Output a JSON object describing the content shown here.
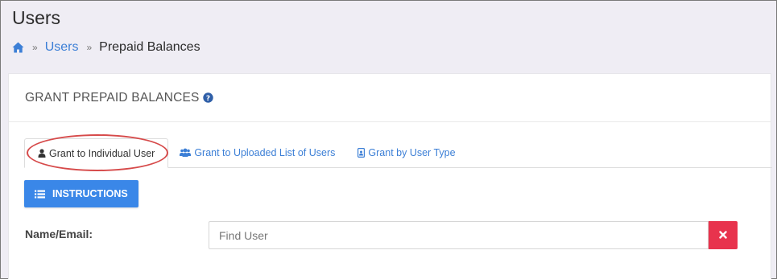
{
  "page": {
    "title": "Users"
  },
  "breadcrumb": {
    "home_icon": "home-icon",
    "separator": "»",
    "items": [
      "Users",
      "Prepaid Balances"
    ]
  },
  "panel": {
    "title": "GRANT PREPAID BALANCES",
    "help_icon": "question-circle-icon"
  },
  "tabs": [
    {
      "label": "Grant to Individual User",
      "icon": "user-icon",
      "active": true
    },
    {
      "label": "Grant to Uploaded List of Users",
      "icon": "users-icon",
      "active": false
    },
    {
      "label": "Grant by User Type",
      "icon": "id-badge-icon",
      "active": false
    }
  ],
  "instructions_button": {
    "label": "INSTRUCTIONS",
    "icon": "list-icon"
  },
  "form": {
    "name_email_label": "Name/Email:",
    "search_placeholder": "Find User",
    "search_value": "",
    "clear_icon": "close-icon"
  },
  "colors": {
    "primary": "#3a87e8",
    "link": "#3c7fd6",
    "danger": "#e8334d",
    "annotation": "#d64a4a",
    "background": "#efedf4"
  }
}
